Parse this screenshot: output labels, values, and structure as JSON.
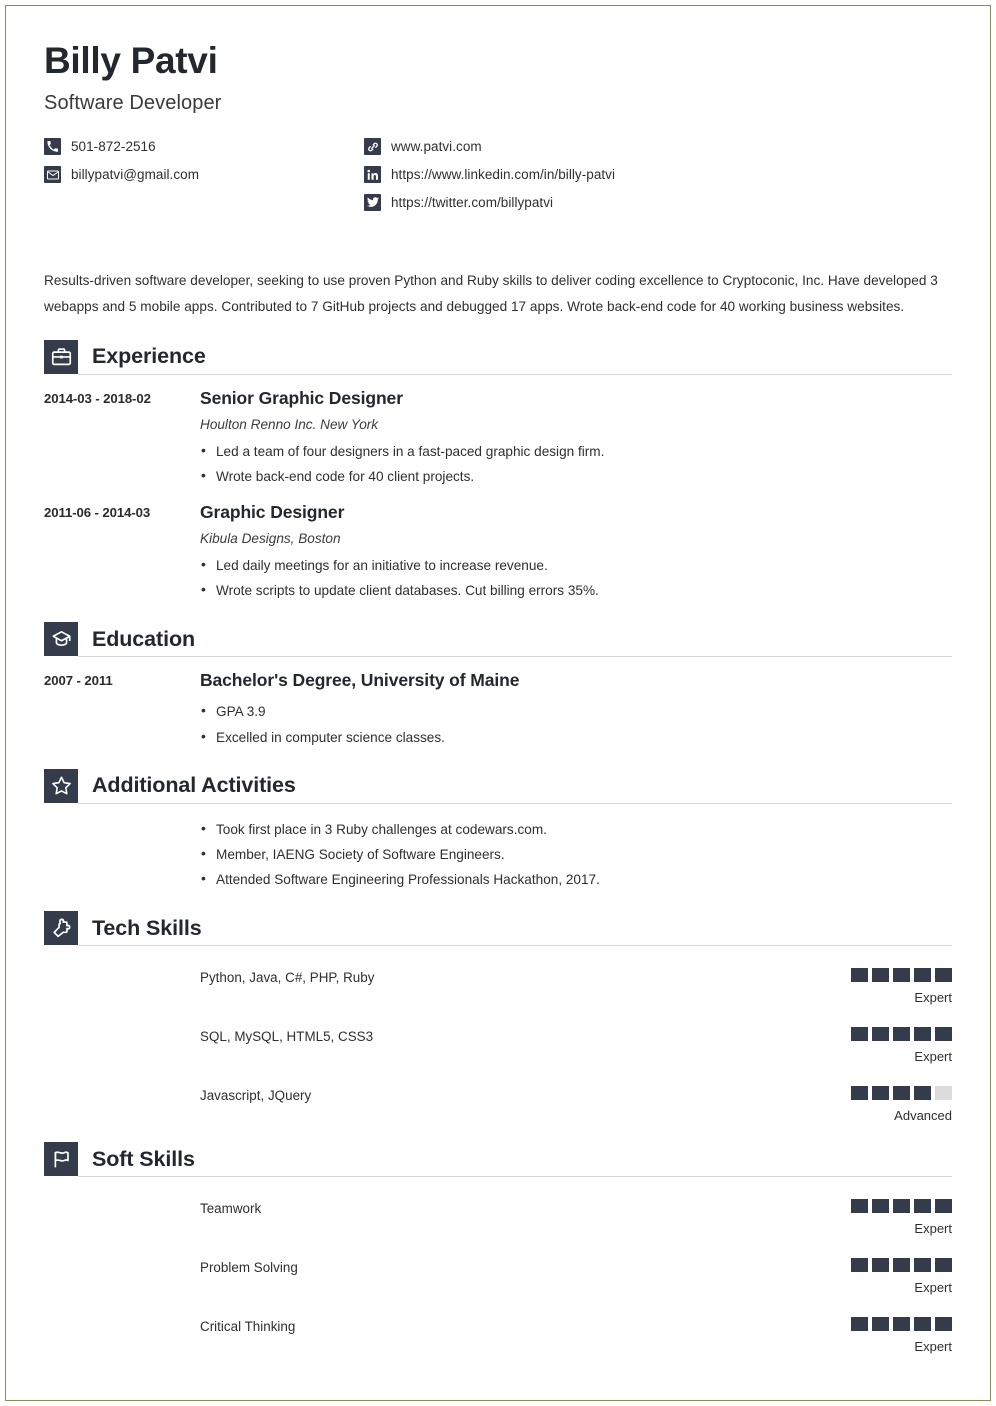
{
  "header": {
    "name": "Billy Patvi",
    "job_title": "Software Developer",
    "contacts_left": [
      {
        "icon": "phone-icon",
        "text": "501-872-2516"
      },
      {
        "icon": "envelope-icon",
        "text": "billypatvi@gmail.com"
      }
    ],
    "contacts_right": [
      {
        "icon": "link-icon",
        "text": "www.patvi.com"
      },
      {
        "icon": "linkedin-icon",
        "text": "https://www.linkedin.com/in/billy-patvi"
      },
      {
        "icon": "twitter-icon",
        "text": "https://twitter.com/billypatvi"
      }
    ]
  },
  "summary": "Results-driven software developer, seeking to use proven Python and Ruby skills to deliver coding excellence to Cryptoconic, Inc. Have developed 3 webapps and 5 mobile apps. Contributed to 7 GitHub projects and debugged 17 apps. Wrote back-end code for 40 working business websites.",
  "sections": {
    "experience": {
      "title": "Experience",
      "icon": "briefcase-icon",
      "entries": [
        {
          "date": "2014-03 - 2018-02",
          "title": "Senior Graphic Designer",
          "subtitle": "Houlton Renno Inc. New York",
          "bullets": [
            "Led a team of four designers in a fast-paced graphic design firm.",
            "Wrote back-end code for 40 client projects."
          ]
        },
        {
          "date": "2011-06 - 2014-03",
          "title": "Graphic Designer",
          "subtitle": "Kibula Designs, Boston",
          "bullets": [
            "Led daily meetings for an initiative to increase revenue.",
            "Wrote scripts to update client databases. Cut billing errors 35%."
          ]
        }
      ]
    },
    "education": {
      "title": "Education",
      "icon": "graduation-cap-icon",
      "entries": [
        {
          "date": "2007 - 2011",
          "title": "Bachelor's Degree, University of Maine",
          "subtitle": "",
          "bullets": [
            "GPA 3.9",
            "Excelled in computer science classes."
          ]
        }
      ]
    },
    "activities": {
      "title": "Additional Activities",
      "icon": "star-icon",
      "bullets": [
        "Took first place in 3 Ruby challenges at codewars.com.",
        "Member, IAENG Society of Software Engineers.",
        "Attended Software Engineering Professionals Hackathon, 2017."
      ]
    },
    "tech_skills": {
      "title": "Tech Skills",
      "icon": "puzzle-icon",
      "max_rating": 5,
      "items": [
        {
          "name": "Python, Java, C#, PHP, Ruby",
          "rating": 5,
          "level": "Expert"
        },
        {
          "name": "SQL, MySQL, HTML5, CSS3",
          "rating": 5,
          "level": "Expert"
        },
        {
          "name": "Javascript, JQuery",
          "rating": 4,
          "level": "Advanced"
        }
      ]
    },
    "soft_skills": {
      "title": "Soft Skills",
      "icon": "flag-icon",
      "max_rating": 5,
      "items": [
        {
          "name": "Teamwork",
          "rating": 5,
          "level": "Expert"
        },
        {
          "name": "Problem Solving",
          "rating": 5,
          "level": "Expert"
        },
        {
          "name": "Critical Thinking",
          "rating": 5,
          "level": "Expert"
        }
      ]
    }
  },
  "colors": {
    "accent_dark": "#343b4a",
    "text": "#2f2f2f",
    "heading": "#23272e",
    "rule": "#d8d8d8",
    "dot_off": "#dcdcdc",
    "page_border": "#8a8a5e"
  }
}
